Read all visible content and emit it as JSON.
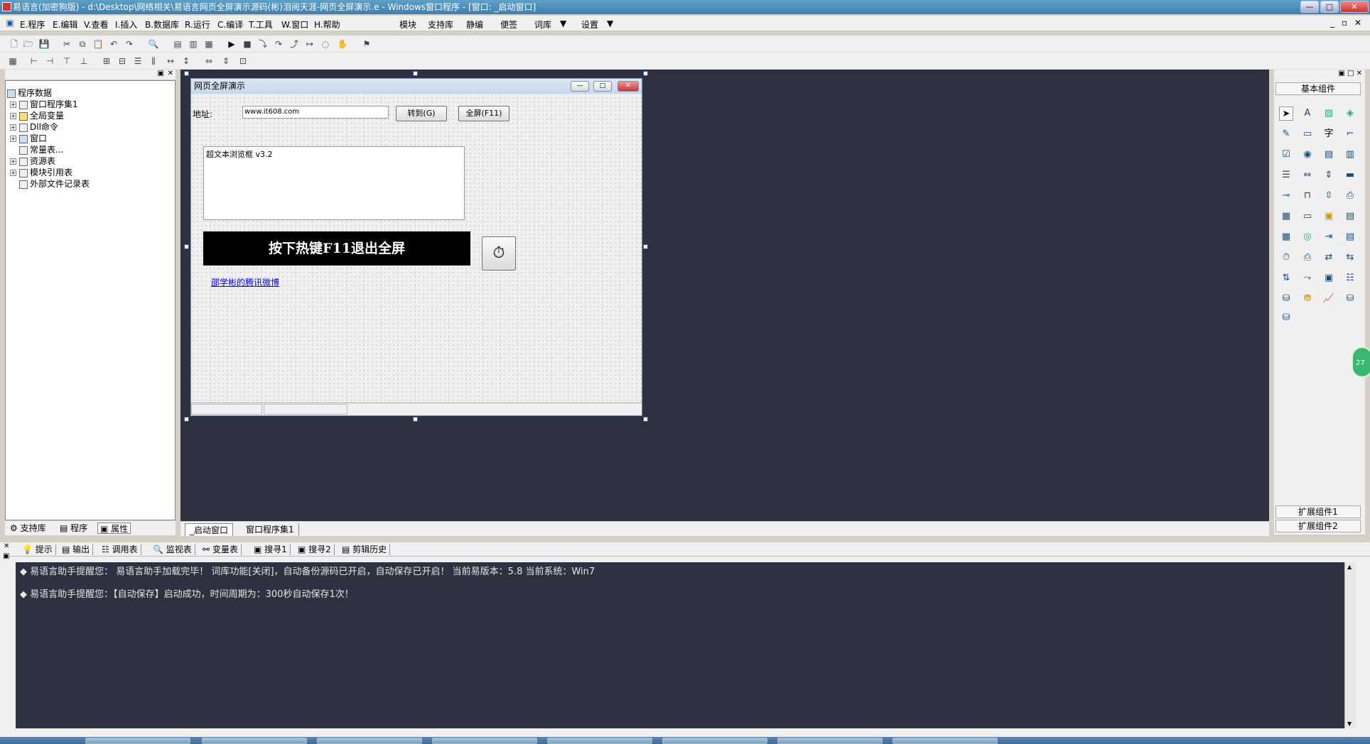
{
  "window": {
    "title": "易语言(加密狗版) - d:\\Desktop\\网络相关\\易语言网页全屏演示源码(彬)泪阅天涯-网页全屏演示.e - Windows窗口程序 - [窗口: _启动窗口]"
  },
  "menu": {
    "items": [
      "E.程序",
      "E.编辑",
      "V.查看",
      "I.插入",
      "B.数据库",
      "R.运行",
      "C.编译",
      "T.工具",
      "W.窗口",
      "H.帮助"
    ],
    "extra": [
      "模块",
      "支持库",
      "静编",
      "便签",
      "词库",
      "设置"
    ]
  },
  "tree": {
    "root": "程序数据",
    "items": [
      "窗口程序集1",
      "全局变量",
      "Dll命令",
      "窗口",
      "常量表...",
      "资源表",
      "模块引用表",
      "外部文件记录表"
    ]
  },
  "left_tabs": [
    "支持库",
    "程序",
    "属性"
  ],
  "form": {
    "title": "网页全屏演示",
    "address_label": "地址:",
    "address_value": "www.it608.com",
    "goto_button": "转到(G)",
    "fullscreen_button": "全屏(F11)",
    "browser_text": "超文本浏览框 v3.2",
    "banner": "按下热键F11退出全屏",
    "link": "邵学彬的腾讯微博"
  },
  "designer_tabs": [
    "_启动窗口",
    "窗口程序集1"
  ],
  "palette": {
    "header": "基本组件",
    "footer": [
      "扩展组件1",
      "扩展组件2"
    ],
    "badge": "27"
  },
  "output_tabs": [
    "提示",
    "输出",
    "调用表",
    "监视表",
    "变量表",
    "搜寻1",
    "搜寻2",
    "剪辑历史"
  ],
  "output_lines": [
    "易语言助手提醒您： 易语言助手加载完毕！ 词库功能[关闭]，自动备份源码已开启，自动保存已开启！ 当前易版本：5.8  当前系统：Win7",
    "易语言助手提醒您：【自动保存】启动成功，时间周期为：300秒自动保存1次！"
  ]
}
